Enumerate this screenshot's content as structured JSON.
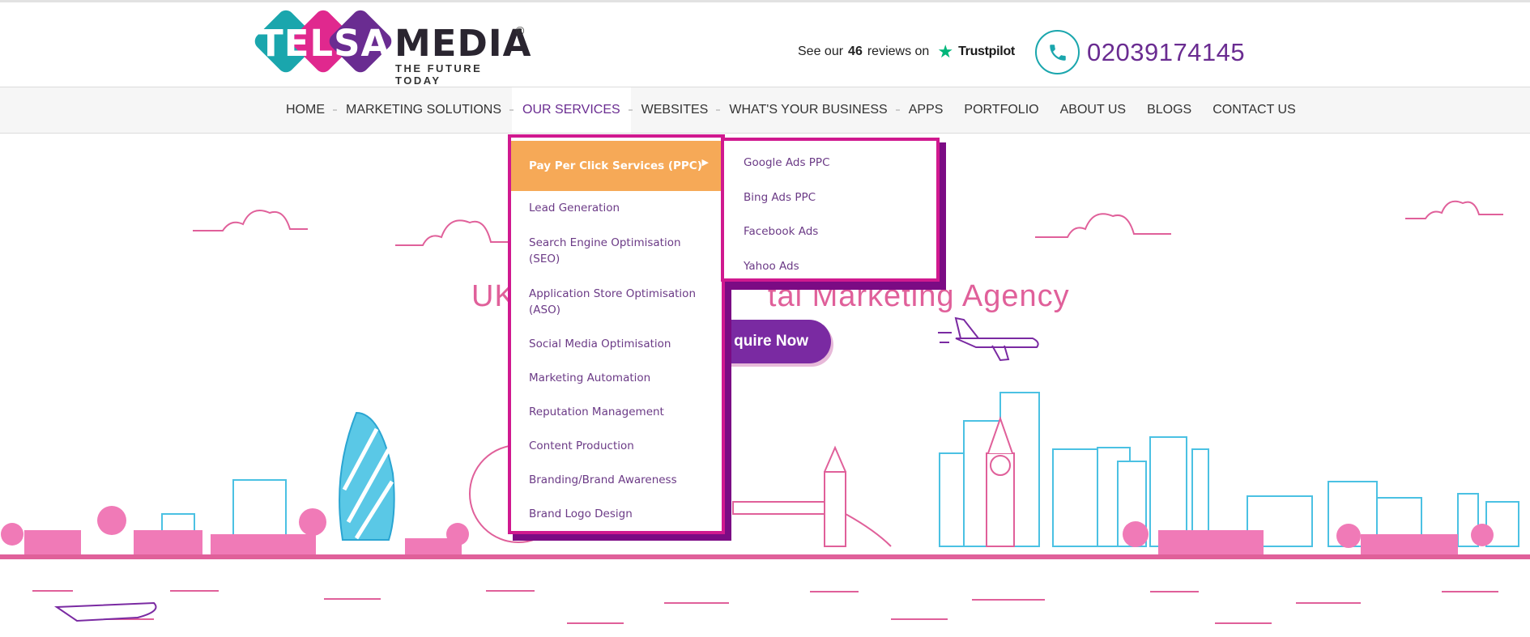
{
  "brand": {
    "logo_left_word": "TELSA",
    "logo_right_word": "MEDIA",
    "registered_mark": "®",
    "tagline": "THE FUTURE TODAY",
    "colors": {
      "teal": "#1aa6ad",
      "magenta": "#d0198f",
      "purple": "#6a2c91",
      "pink": "#e0609a",
      "orange": "#f6a957"
    }
  },
  "trustpilot": {
    "prefix": "See our",
    "count": "46",
    "suffix": "reviews on",
    "star_icon": "trustpilot-star-icon",
    "name": "Trustpilot"
  },
  "contact": {
    "phone_icon": "phone-icon",
    "phone_number": "02039174145"
  },
  "nav": {
    "items": [
      {
        "label": "HOME"
      },
      {
        "label": "MARKETING SOLUTIONS"
      },
      {
        "label": "OUR SERVICES"
      },
      {
        "label": "WEBSITES"
      },
      {
        "label": "WHAT'S YOUR BUSINESS"
      },
      {
        "label": "APPS"
      },
      {
        "label": "PORTFOLIO"
      },
      {
        "label": "ABOUT US"
      },
      {
        "label": "BLOGS"
      },
      {
        "label": "CONTACT US"
      }
    ]
  },
  "services_menu": {
    "items": [
      {
        "label": "Pay Per Click Services (PPC)"
      },
      {
        "label": "Lead Generation"
      },
      {
        "label": "Search Engine Optimisation (SEO)"
      },
      {
        "label": "Application Store Optimisation (ASO)"
      },
      {
        "label": "Social Media Optimisation"
      },
      {
        "label": "Marketing Automation"
      },
      {
        "label": "Reputation Management"
      },
      {
        "label": "Content Production"
      },
      {
        "label": "Branding/Brand Awareness"
      },
      {
        "label": "Brand Logo Design"
      }
    ],
    "arrow_icon": "caret-right-icon"
  },
  "ppc_submenu": {
    "items": [
      {
        "label": "Google Ads PPC"
      },
      {
        "label": "Bing Ads PPC"
      },
      {
        "label": "Facebook Ads"
      },
      {
        "label": "Yahoo Ads"
      }
    ]
  },
  "hero": {
    "title_visible_left": "UK",
    "title_visible_right": "tal Marketing Agency",
    "cta_visible": "quire Now",
    "illustration": "london-skyline-illustration"
  }
}
